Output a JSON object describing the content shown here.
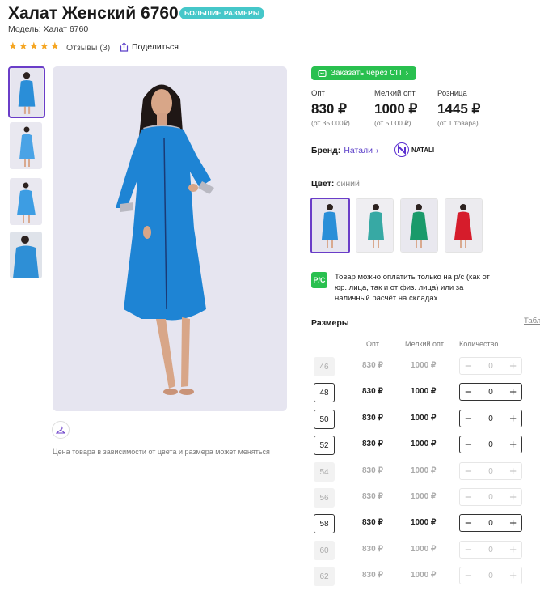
{
  "header": {
    "title": "Халат Женский 6760",
    "badge": "БОЛЬШИЕ РАЗМЕРЫ",
    "model": "Модель: Халат 6760",
    "reviews": "Отзывы (3)",
    "share": "Поделиться",
    "rating_stars": 5
  },
  "gallery": {
    "note": "Цена товара в зависимости от цвета и размера может меняться"
  },
  "order": {
    "sp_button": "Заказать через СП"
  },
  "prices": [
    {
      "label": "Опт",
      "value": "830 ₽",
      "sub": "(от 35 000₽)"
    },
    {
      "label": "Мелкий опт",
      "value": "1000 ₽",
      "sub": "(от 5 000 ₽)"
    },
    {
      "label": "Розница",
      "value": "1445 ₽",
      "sub": "(от 1 товара)"
    }
  ],
  "brand": {
    "label": "Бренд:",
    "value": "Натали",
    "logo_text": "NATALI"
  },
  "color": {
    "label": "Цвет:",
    "value": "синий"
  },
  "payment": {
    "icon_text": "Р/С",
    "text": "Товар можно оплатить только на р/с (как от юр. лица, так и от физ. лица) или за наличный расчёт на складах"
  },
  "sizes": {
    "title": "Размеры",
    "table_link": "Табл",
    "columns": [
      "Опт",
      "Мелкий опт",
      "Количество"
    ],
    "rows": [
      {
        "size": "46",
        "opt": "830 ₽",
        "small": "1000 ₽",
        "qty": "0",
        "available": false
      },
      {
        "size": "48",
        "opt": "830 ₽",
        "small": "1000 ₽",
        "qty": "0",
        "available": true
      },
      {
        "size": "50",
        "opt": "830 ₽",
        "small": "1000 ₽",
        "qty": "0",
        "available": true
      },
      {
        "size": "52",
        "opt": "830 ₽",
        "small": "1000 ₽",
        "qty": "0",
        "available": true
      },
      {
        "size": "54",
        "opt": "830 ₽",
        "small": "1000 ₽",
        "qty": "0",
        "available": false
      },
      {
        "size": "56",
        "opt": "830 ₽",
        "small": "1000 ₽",
        "qty": "0",
        "available": false
      },
      {
        "size": "58",
        "opt": "830 ₽",
        "small": "1000 ₽",
        "qty": "0",
        "available": true
      },
      {
        "size": "60",
        "opt": "830 ₽",
        "small": "1000 ₽",
        "qty": "0",
        "available": false
      },
      {
        "size": "62",
        "opt": "830 ₽",
        "small": "1000 ₽",
        "qty": "0",
        "available": false
      }
    ]
  },
  "colors_accent": {
    "purple": "#6a3dc8",
    "green": "#29c04f",
    "teal": "#45c7c9",
    "star": "#f5a623"
  }
}
